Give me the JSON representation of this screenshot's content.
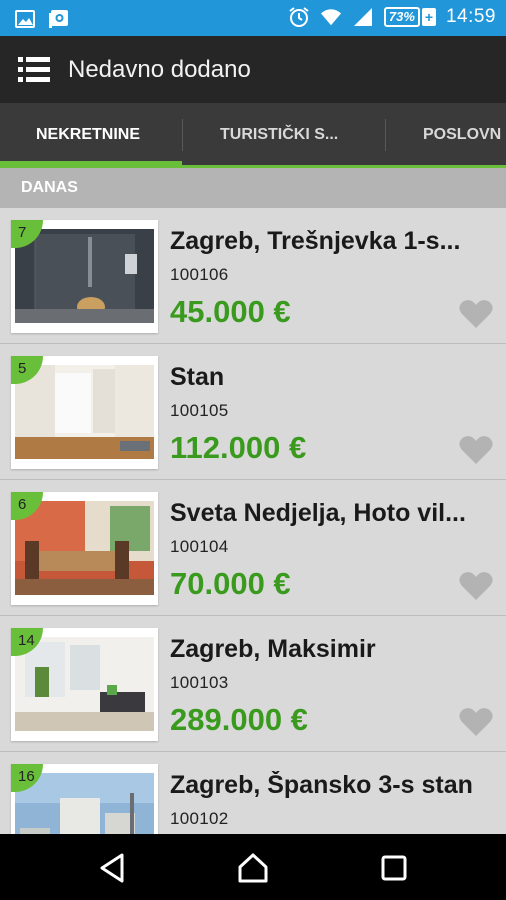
{
  "status_bar": {
    "battery": "73%",
    "battery_plus": "+",
    "time": "14:59",
    "color": "#2196d9"
  },
  "app_bar": {
    "title": "Nedavno dodano"
  },
  "tabs": [
    {
      "label": "NEKRETNINE",
      "active": true
    },
    {
      "label": "TURISTIČKI S...",
      "active": false
    },
    {
      "label": "POSLOVN",
      "active": false
    }
  ],
  "section": {
    "label": "DANAS"
  },
  "listings": [
    {
      "badge": "7",
      "title": "Zagreb, Trešnjevka 1-s...",
      "code": "100106",
      "price": "45.000 €",
      "image": "bathroom-photo"
    },
    {
      "badge": "5",
      "title": "Stan",
      "code": "100105",
      "price": "112.000 €",
      "image": "empty-room-photo"
    },
    {
      "badge": "6",
      "title": "Sveta Nedjelja, Hoto vil...",
      "code": "100104",
      "price": "70.000 €",
      "image": "dining-room-photo"
    },
    {
      "badge": "14",
      "title": "Zagreb, Maksimir",
      "code": "100103",
      "price": "289.000 €",
      "image": "living-room-photo"
    },
    {
      "badge": "16",
      "title": "Zagreb, Špansko 3-s stan",
      "code": "100102",
      "price": "",
      "image": "building-exterior-photo"
    }
  ],
  "colors": {
    "accent": "#6abf3a",
    "price": "#3a9a1e",
    "app_bar": "#262626",
    "tab_bar": "#3a3a3a"
  }
}
